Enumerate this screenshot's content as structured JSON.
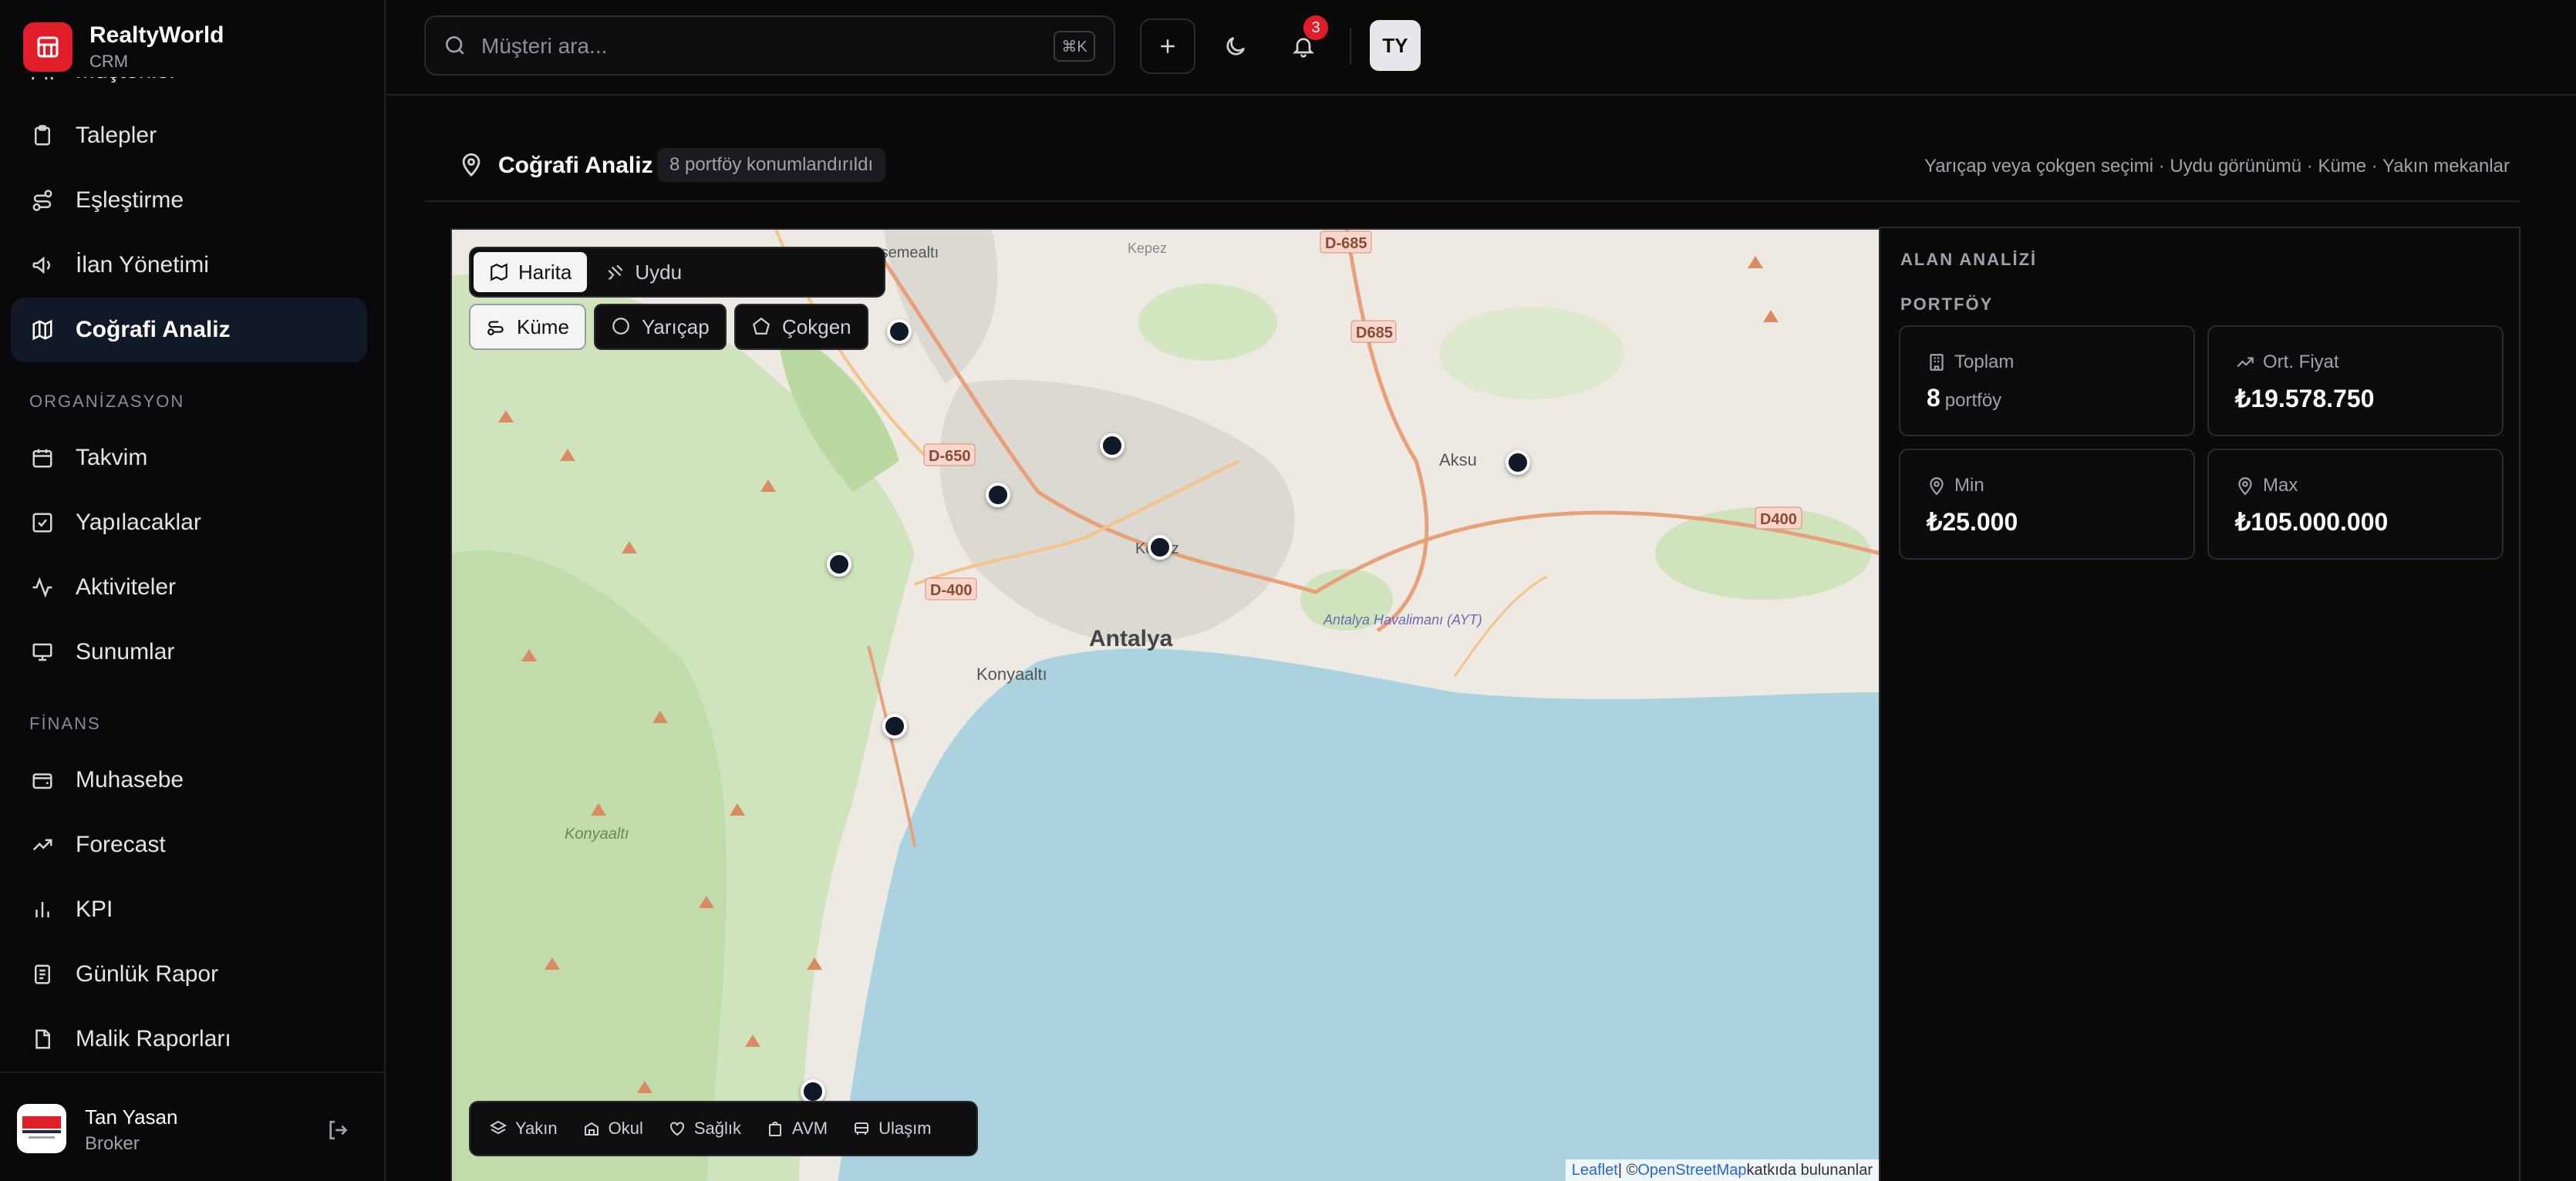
{
  "brand": {
    "name": "RealtyWorld",
    "sub": "CRM"
  },
  "sidebar": {
    "items_top": [
      {
        "label": "Müşteriler",
        "icon": "users-icon"
      },
      {
        "label": "Talepler",
        "icon": "clipboard-icon"
      },
      {
        "label": "Eşleştirme",
        "icon": "route-icon"
      },
      {
        "label": "İlan Yönetimi",
        "icon": "megaphone-icon"
      },
      {
        "label": "Coğrafi Analiz",
        "icon": "map-icon",
        "active": true
      }
    ],
    "section_org": "ORGANİZASYON",
    "items_org": [
      {
        "label": "Takvim",
        "icon": "calendar-icon"
      },
      {
        "label": "Yapılacaklar",
        "icon": "checkbox-icon"
      },
      {
        "label": "Aktiviteler",
        "icon": "activity-icon"
      },
      {
        "label": "Sunumlar",
        "icon": "presentation-icon"
      }
    ],
    "section_fin": "FİNANS",
    "items_fin": [
      {
        "label": "Muhasebe",
        "icon": "wallet-icon"
      },
      {
        "label": "Forecast",
        "icon": "trending-up-icon"
      },
      {
        "label": "KPI",
        "icon": "bar-chart-icon"
      },
      {
        "label": "Günlük Rapor",
        "icon": "report-icon"
      },
      {
        "label": "Malik Raporları",
        "icon": "file-icon"
      }
    ]
  },
  "user": {
    "name": "Tan Yasan",
    "role": "Broker"
  },
  "header": {
    "search_placeholder": "Müşteri ara...",
    "shortcut": "⌘K",
    "notifications": "3",
    "avatar_initials": "TY"
  },
  "page": {
    "title": "Coğrafi Analiz",
    "chip": "8 portföy konumlandırıldı",
    "hint": "Yarıçap veya çokgen seçimi · Uydu görünümü · Küme · Yakın mekanlar"
  },
  "map": {
    "view_toggle": [
      "Harita",
      "Uydu"
    ],
    "tools": [
      "Küme",
      "Yarıçap",
      "Çokgen"
    ],
    "poi_filters": [
      "Yakın",
      "Okul",
      "Sağlık",
      "AVM",
      "Ulaşım"
    ],
    "labels": {
      "city": "Antalya",
      "konyaalti": "Konyaaltı",
      "konyaalti2": "Konyaaltı",
      "dosemealti": "Döşemealtı",
      "kepez": "Kepez",
      "aksu": "Aksu",
      "airport": "Antalya Havalimanı (AYT)",
      "kepez_short": "Kepez"
    },
    "roads": [
      "D-685",
      "D685",
      "D-650",
      "D-400",
      "D400"
    ],
    "attribution": {
      "leaflet": "Leaflet",
      "sep": " | © ",
      "osm": "OpenStreetMap",
      "suffix": " katkıda bulunanlar"
    }
  },
  "panel": {
    "title": "ALAN ANALİZİ",
    "subtitle": "PORTFÖY",
    "cards": [
      {
        "label": "Toplam",
        "value": "8",
        "unit": "portföy",
        "icon": "building-icon"
      },
      {
        "label": "Ort. Fiyat",
        "value": "₺19.578.750",
        "icon": "trending-up-icon"
      },
      {
        "label": "Min",
        "value": "₺25.000",
        "icon": "map-pin-icon"
      },
      {
        "label": "Max",
        "value": "₺105.000.000",
        "icon": "map-pin-icon"
      }
    ]
  }
}
